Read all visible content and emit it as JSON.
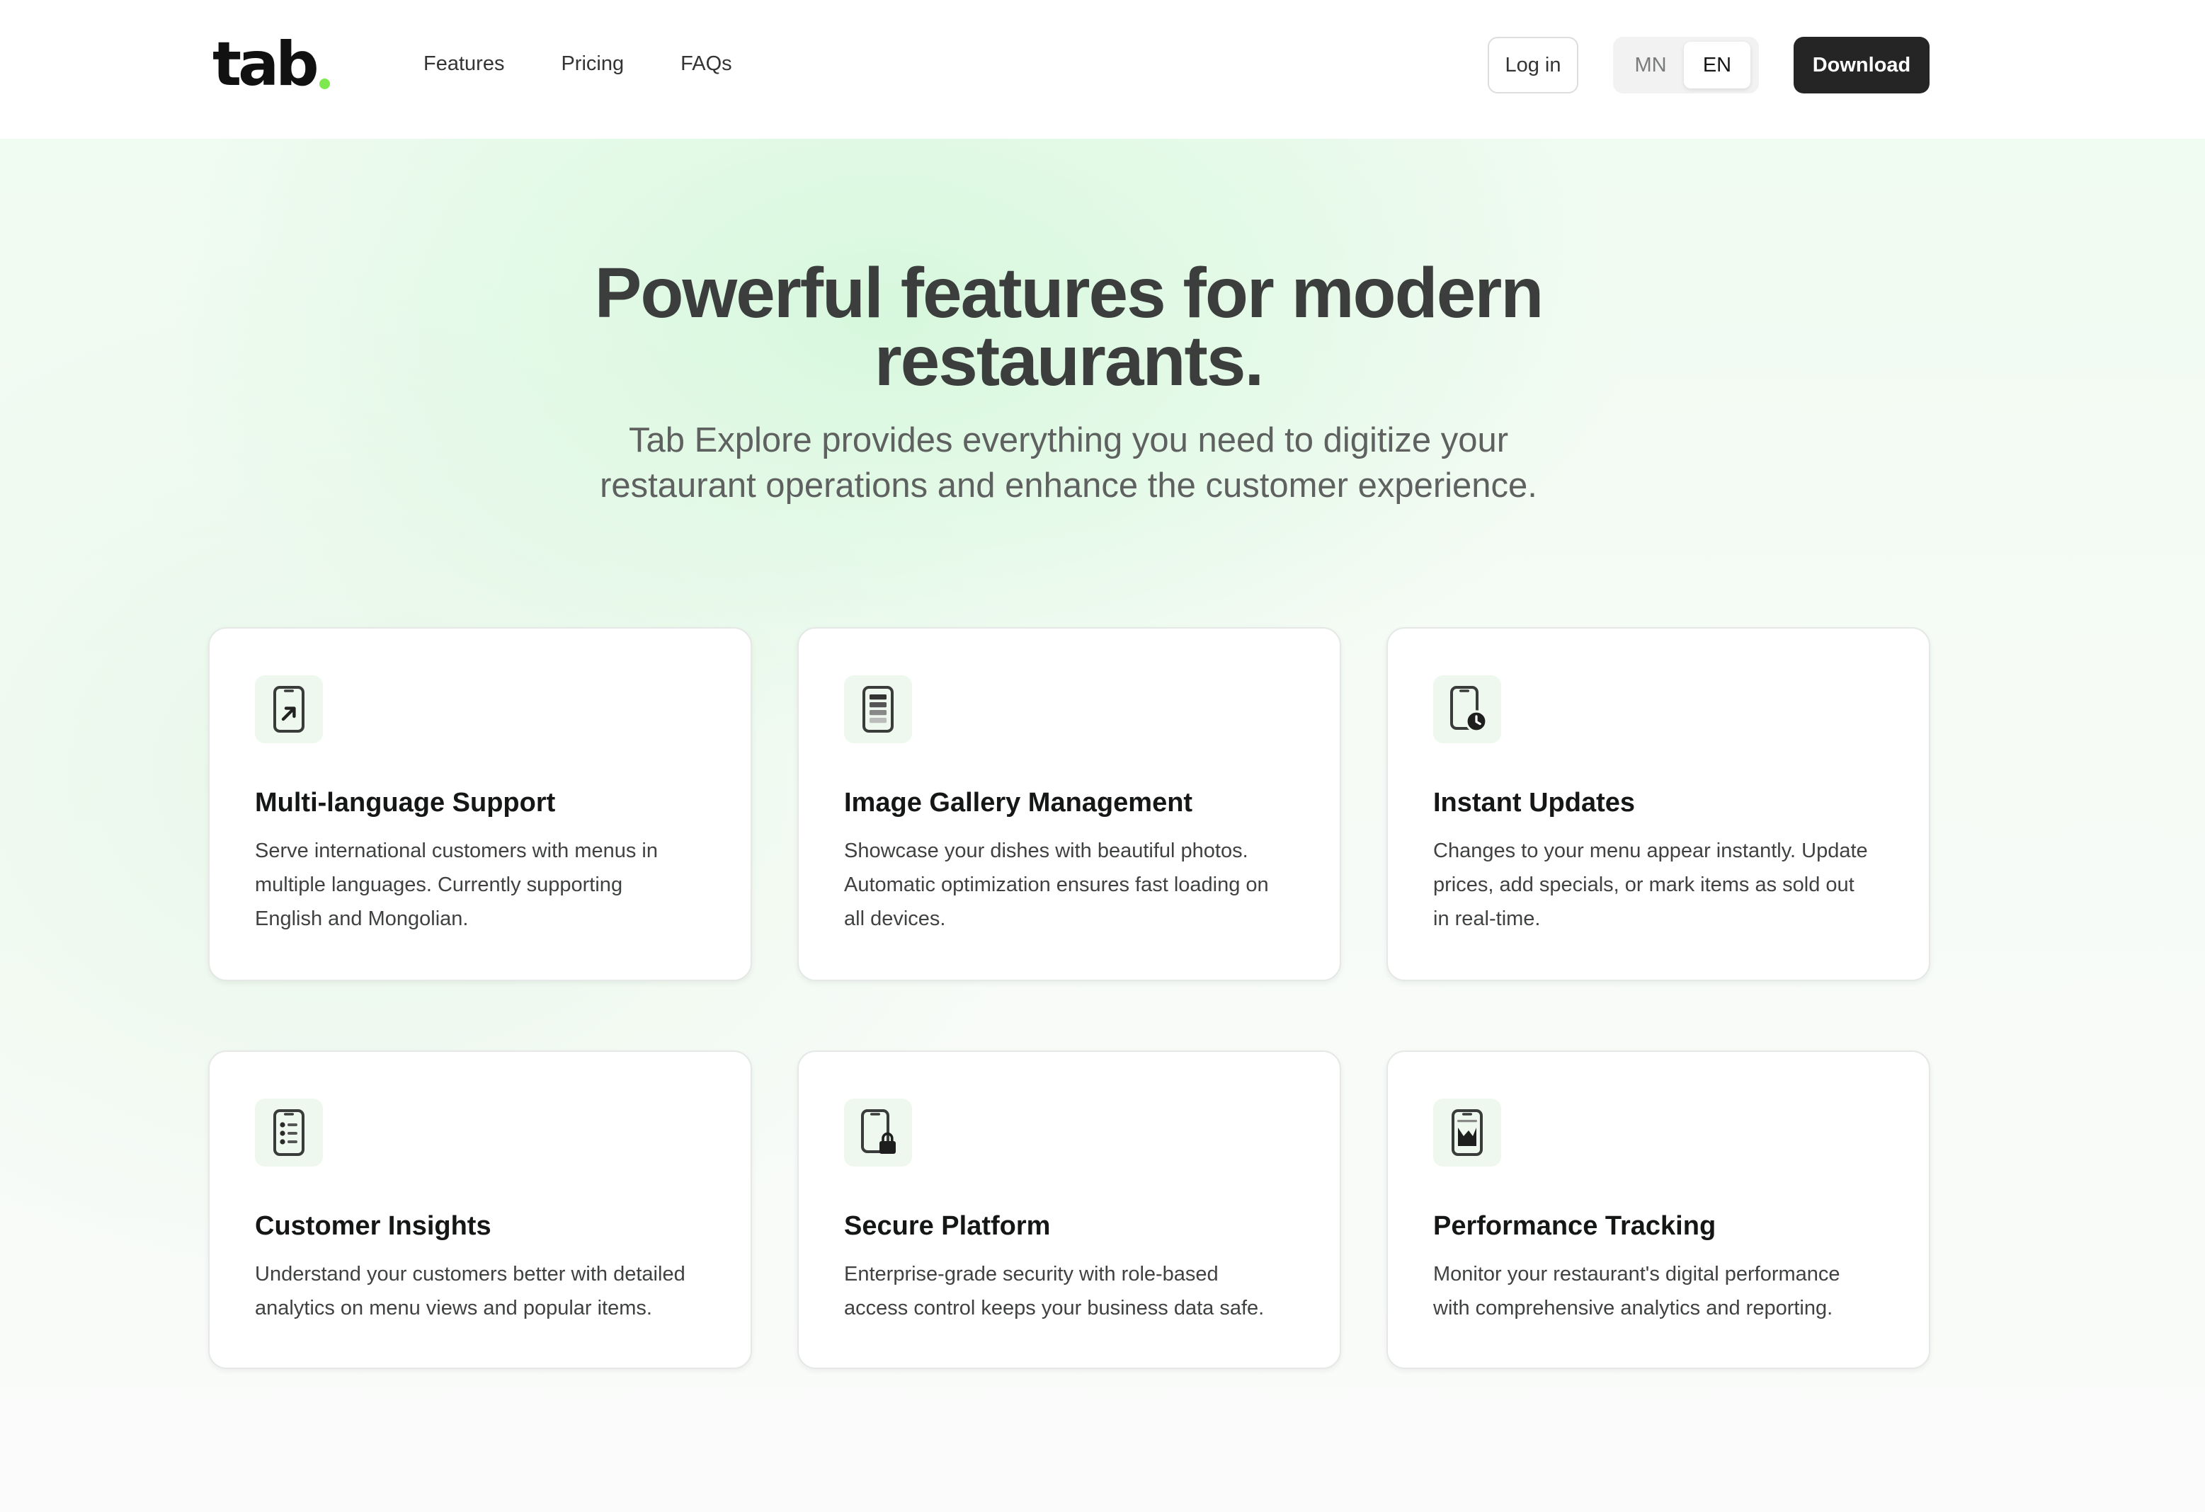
{
  "header": {
    "logo_text": "tab",
    "nav": [
      {
        "label": "Features"
      },
      {
        "label": "Pricing"
      },
      {
        "label": "FAQs"
      }
    ],
    "login_label": "Log in",
    "languages": [
      {
        "label": "MN",
        "active": false
      },
      {
        "label": "EN",
        "active": true
      }
    ],
    "download_label": "Download",
    "accent_color": "#7ee84f"
  },
  "hero": {
    "title_line1": "Powerful features for modern",
    "title_line2": "restaurants.",
    "subtitle_line1": "Tab Explore provides everything you need to digitize your",
    "subtitle_line2": "restaurant operations and enhance the customer experience."
  },
  "features": [
    {
      "icon": "phone-arrow-icon",
      "title": "Multi-language Support",
      "desc_lines": [
        "Serve international customers with menus in",
        "multiple languages. Currently supporting",
        "English and Mongolian."
      ]
    },
    {
      "icon": "phone-gallery-icon",
      "title": "Image Gallery Management",
      "desc_lines": [
        "Showcase your dishes with beautiful photos.",
        "Automatic optimization ensures fast loading on",
        "all devices."
      ]
    },
    {
      "icon": "phone-clock-icon",
      "title": "Instant Updates",
      "desc_lines": [
        "Changes to your menu appear instantly. Update",
        "prices, add specials, or mark items as sold out",
        "in real-time."
      ]
    },
    {
      "icon": "phone-list-icon",
      "title": "Customer Insights",
      "desc_lines": [
        "Understand your customers better with detailed",
        "analytics on menu views and popular items."
      ]
    },
    {
      "icon": "phone-lock-icon",
      "title": "Secure Platform",
      "desc_lines": [
        "Enterprise-grade security with role-based",
        "access control keeps your business data safe."
      ]
    },
    {
      "icon": "phone-chart-icon",
      "title": "Performance Tracking",
      "desc_lines": [
        "Monitor your restaurant's digital performance",
        "with comprehensive analytics and reporting."
      ]
    }
  ]
}
